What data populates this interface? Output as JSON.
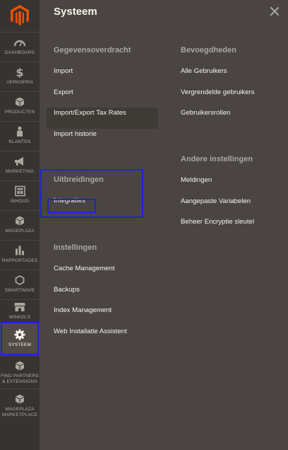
{
  "sidebar": {
    "items": [
      {
        "label": "DASHBOARD",
        "icon": "speedometer-icon"
      },
      {
        "label": "VERKOPEN",
        "icon": "dollar-icon"
      },
      {
        "label": "PRODUCTEN",
        "icon": "cube-icon"
      },
      {
        "label": "KLANTEN",
        "icon": "person-icon"
      },
      {
        "label": "MARKETING",
        "icon": "megaphone-icon"
      },
      {
        "label": "INHOUD",
        "icon": "layout-icon"
      },
      {
        "label": "MAGEPLAZA",
        "icon": "mageplaza-cube-icon"
      },
      {
        "label": "RAPPORTAGES",
        "icon": "bar-chart-icon"
      },
      {
        "label": "SMARTWAVE",
        "icon": "hexagon-icon"
      },
      {
        "label": "WINKELS",
        "icon": "storefront-icon"
      },
      {
        "label": "SYSTEEM",
        "icon": "gear-icon",
        "active": true
      },
      {
        "label": "FIND PARTNERS",
        "label2": "& EXTENSIONS",
        "icon": "extension-box-icon"
      },
      {
        "label": "MAGEPLAZA",
        "label2": "MARKETPLACE",
        "icon": "marketplace-cube-icon"
      }
    ]
  },
  "panel": {
    "title": "Systeem",
    "groups": {
      "gegevens": {
        "title": "Gegevensoverdracht",
        "links": [
          "Import",
          "Export",
          "Import/Export Tax Rates",
          "Import historie"
        ]
      },
      "uitbreidingen": {
        "title": "Uitbreidingen",
        "links": [
          "Integraties"
        ]
      },
      "instellingen": {
        "title": "Instellingen",
        "links": [
          "Cache Management",
          "Backups",
          "Index Management",
          "Web Installatie Assistent"
        ]
      },
      "bevoegdheden": {
        "title": "Bevoegdheden",
        "links": [
          "Alle Gebruikers",
          "Vergrendelde gebruikers",
          "Gebruikersrollen"
        ]
      },
      "andere": {
        "title": "Andere instellingen",
        "links": [
          "Meldingen",
          "Aangepaste Variabelen",
          "Beheer Encryptie sleutel"
        ]
      }
    }
  },
  "colors": {
    "sidebar_bg": "#373330",
    "panel_bg": "#4a4542",
    "highlight": "#1c23d8",
    "logo": "#eb5202"
  }
}
